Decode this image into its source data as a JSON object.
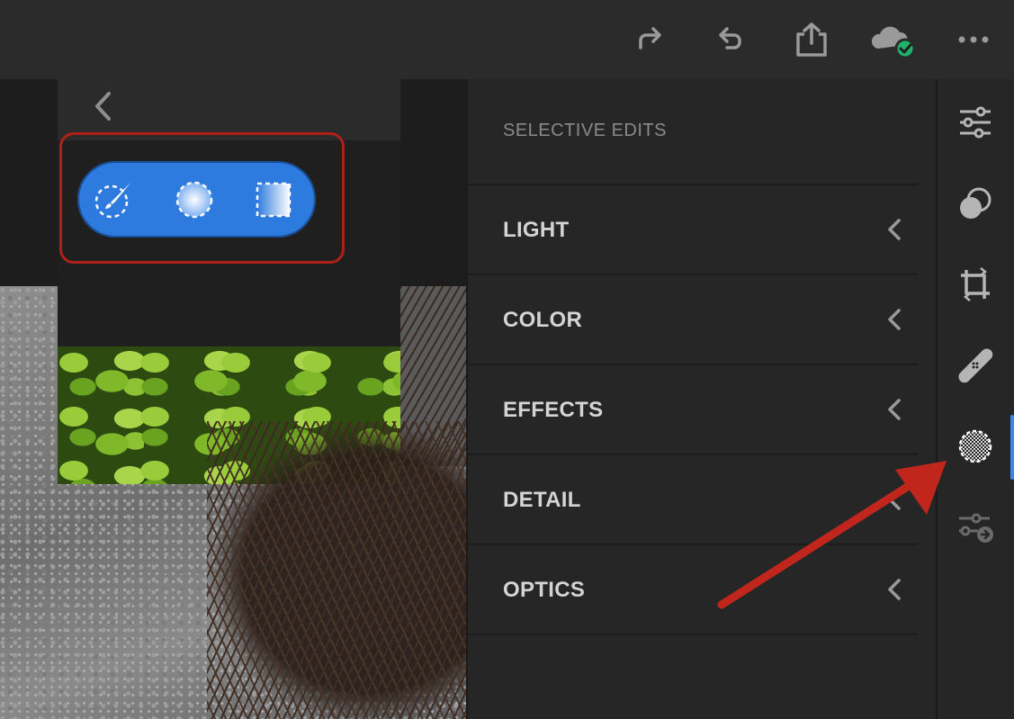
{
  "topbar": {
    "buttons": [
      {
        "name": "redo",
        "icon": "redo-icon"
      },
      {
        "name": "undo",
        "icon": "undo-icon"
      },
      {
        "name": "share",
        "icon": "share-icon"
      },
      {
        "name": "cloud-synced",
        "icon": "cloud-check-icon"
      },
      {
        "name": "more",
        "icon": "more-horizontal-icon"
      }
    ]
  },
  "mask_tools": {
    "items": [
      {
        "name": "brush",
        "icon": "brush-mask-icon"
      },
      {
        "name": "radial",
        "icon": "radial-gradient-icon"
      },
      {
        "name": "linear",
        "icon": "linear-gradient-icon"
      }
    ],
    "accent": "#2e7be0"
  },
  "side_panel": {
    "title": "SELECTIVE EDITS",
    "sections": [
      {
        "label": "LIGHT"
      },
      {
        "label": "COLOR"
      },
      {
        "label": "EFFECTS"
      },
      {
        "label": "DETAIL"
      },
      {
        "label": "OPTICS"
      }
    ]
  },
  "rail": {
    "items": [
      {
        "name": "edit",
        "icon": "sliders-icon"
      },
      {
        "name": "presets",
        "icon": "presets-icon"
      },
      {
        "name": "crop",
        "icon": "crop-icon"
      },
      {
        "name": "healing",
        "icon": "bandage-icon"
      },
      {
        "name": "selective",
        "icon": "selective-mask-icon",
        "active": true
      },
      {
        "name": "versions",
        "icon": "versions-sliders-icon"
      }
    ],
    "active_color": "#3b86f0"
  },
  "annotations": {
    "highlight_color": "#b0201a",
    "arrow_color": "#c0261c"
  }
}
